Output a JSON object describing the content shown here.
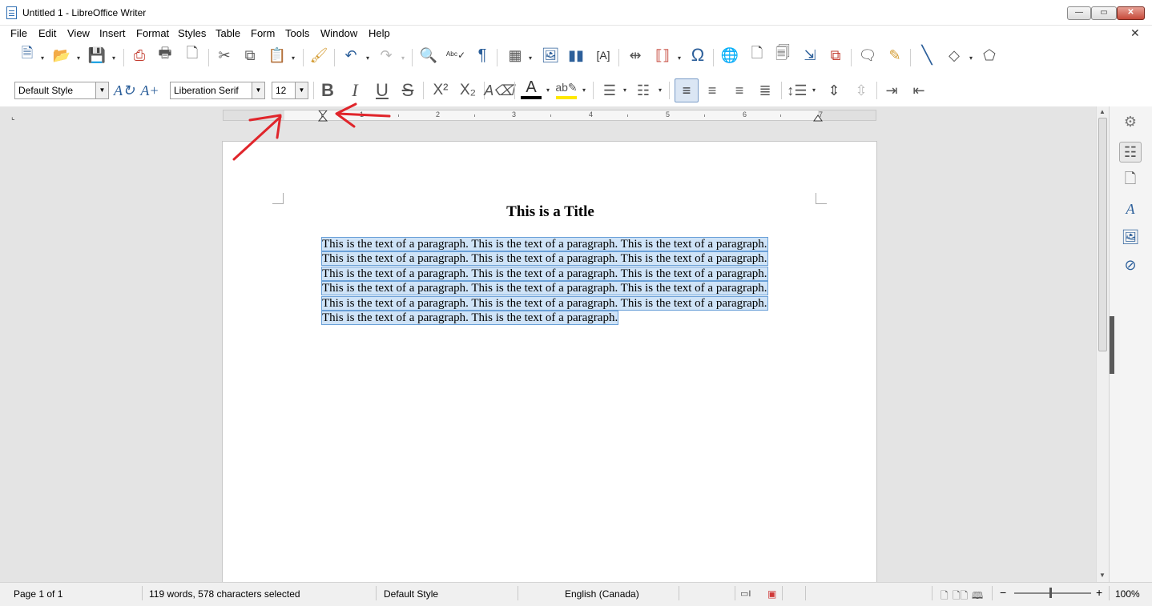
{
  "window": {
    "title": "Untitled 1 - LibreOffice Writer",
    "minimize_glyph": "—",
    "maximize_glyph": "▭",
    "close_glyph": "✕"
  },
  "menu": {
    "items": [
      "File",
      "Edit",
      "View",
      "Insert",
      "Format",
      "Styles",
      "Table",
      "Form",
      "Tools",
      "Window",
      "Help"
    ],
    "close_doc_glyph": "✕"
  },
  "formatting": {
    "paragraph_style": "Default Style",
    "font_name": "Liberation Serif",
    "font_size": "12",
    "bold_glyph": "B",
    "italic_glyph": "I",
    "underline_glyph": "U",
    "strike_glyph": "S",
    "superscript_glyph": "X²",
    "subscript_glyph": "X₂"
  },
  "ruler": {
    "numbers": [
      "1",
      "2",
      "3",
      "4",
      "5",
      "6",
      "7"
    ]
  },
  "document": {
    "title": "This is a Title",
    "paragraph_lines": [
      "This is the text of a paragraph.  This is the text of a paragraph.  This is the text of a paragraph.",
      "This is the text of a paragraph.  This is the text of a paragraph.  This is the text of a paragraph.",
      "This is the text of a paragraph.  This is the text of a paragraph.  This is the text of a paragraph.",
      "This is the text of a paragraph.  This is the text of a paragraph.  This is the text of a paragraph.",
      "This is the text of a paragraph.  This is the text of a paragraph.  This is the text of a paragraph.",
      "This is the text of a paragraph.  This is the text of a paragraph. "
    ]
  },
  "status": {
    "page": "Page 1 of 1",
    "words": "119 words, 578 characters selected",
    "page_style": "Default Style",
    "language": "English (Canada)",
    "zoom": "100%",
    "zoom_minus": "−",
    "zoom_plus": "+"
  },
  "colors": {
    "selection": "#cfe3f7",
    "annotation_arrow": "#e0252b",
    "icon_blue": "#2c5f9a"
  }
}
